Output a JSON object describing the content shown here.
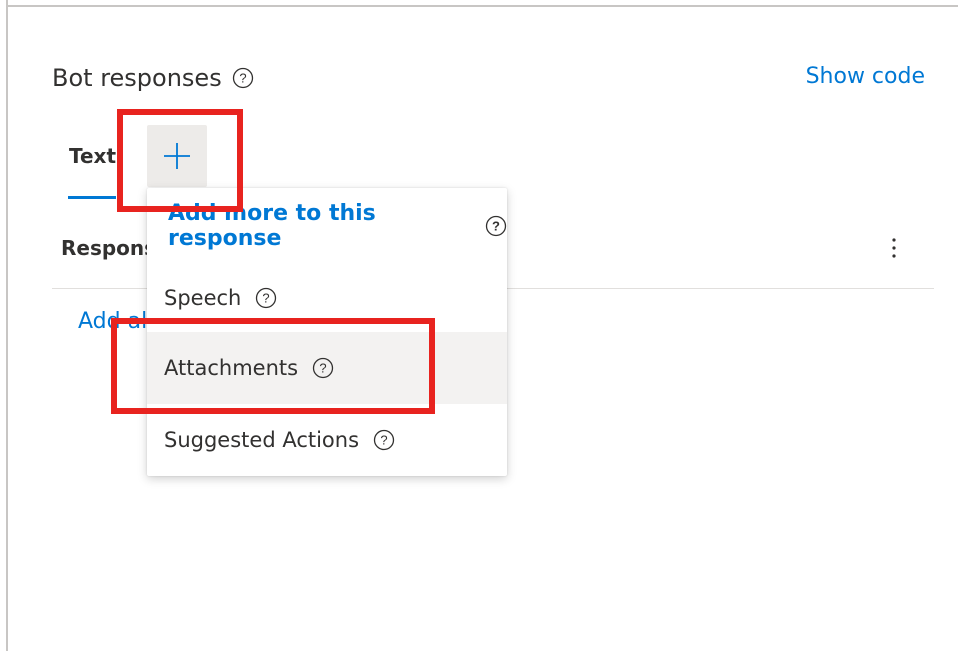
{
  "section": {
    "title": "Bot responses",
    "show_code_label": "Show code"
  },
  "tabs": [
    {
      "label": "Text"
    }
  ],
  "add_button": {
    "icon": "plus-icon"
  },
  "responses": {
    "title_visible": "Respons",
    "add_link_visible": "Add al"
  },
  "dropdown": {
    "header": "Add more to this response",
    "items": [
      {
        "label": "Speech"
      },
      {
        "label": "Attachments"
      },
      {
        "label": "Suggested Actions"
      }
    ]
  },
  "colors": {
    "accent": "#0078d4",
    "annotation": "#e8231f",
    "hover": "#f3f2f1"
  }
}
